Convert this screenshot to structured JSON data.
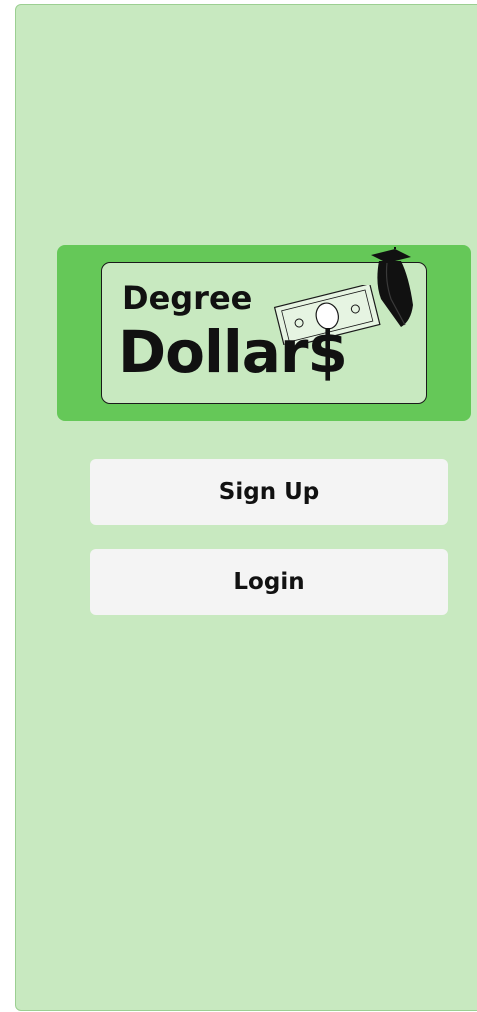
{
  "logo": {
    "line1": "Degree",
    "line2": "Dollar$",
    "colors": {
      "banner": "#65c858",
      "card": "#c8e9c0",
      "text": "#111111"
    },
    "icons": [
      "dollar-bill-icon",
      "graduation-cap-icon"
    ]
  },
  "actions": {
    "signup_label": "Sign Up",
    "login_label": "Login"
  },
  "theme": {
    "background": "#c8e9c0",
    "button_bg": "#f4f4f4"
  }
}
